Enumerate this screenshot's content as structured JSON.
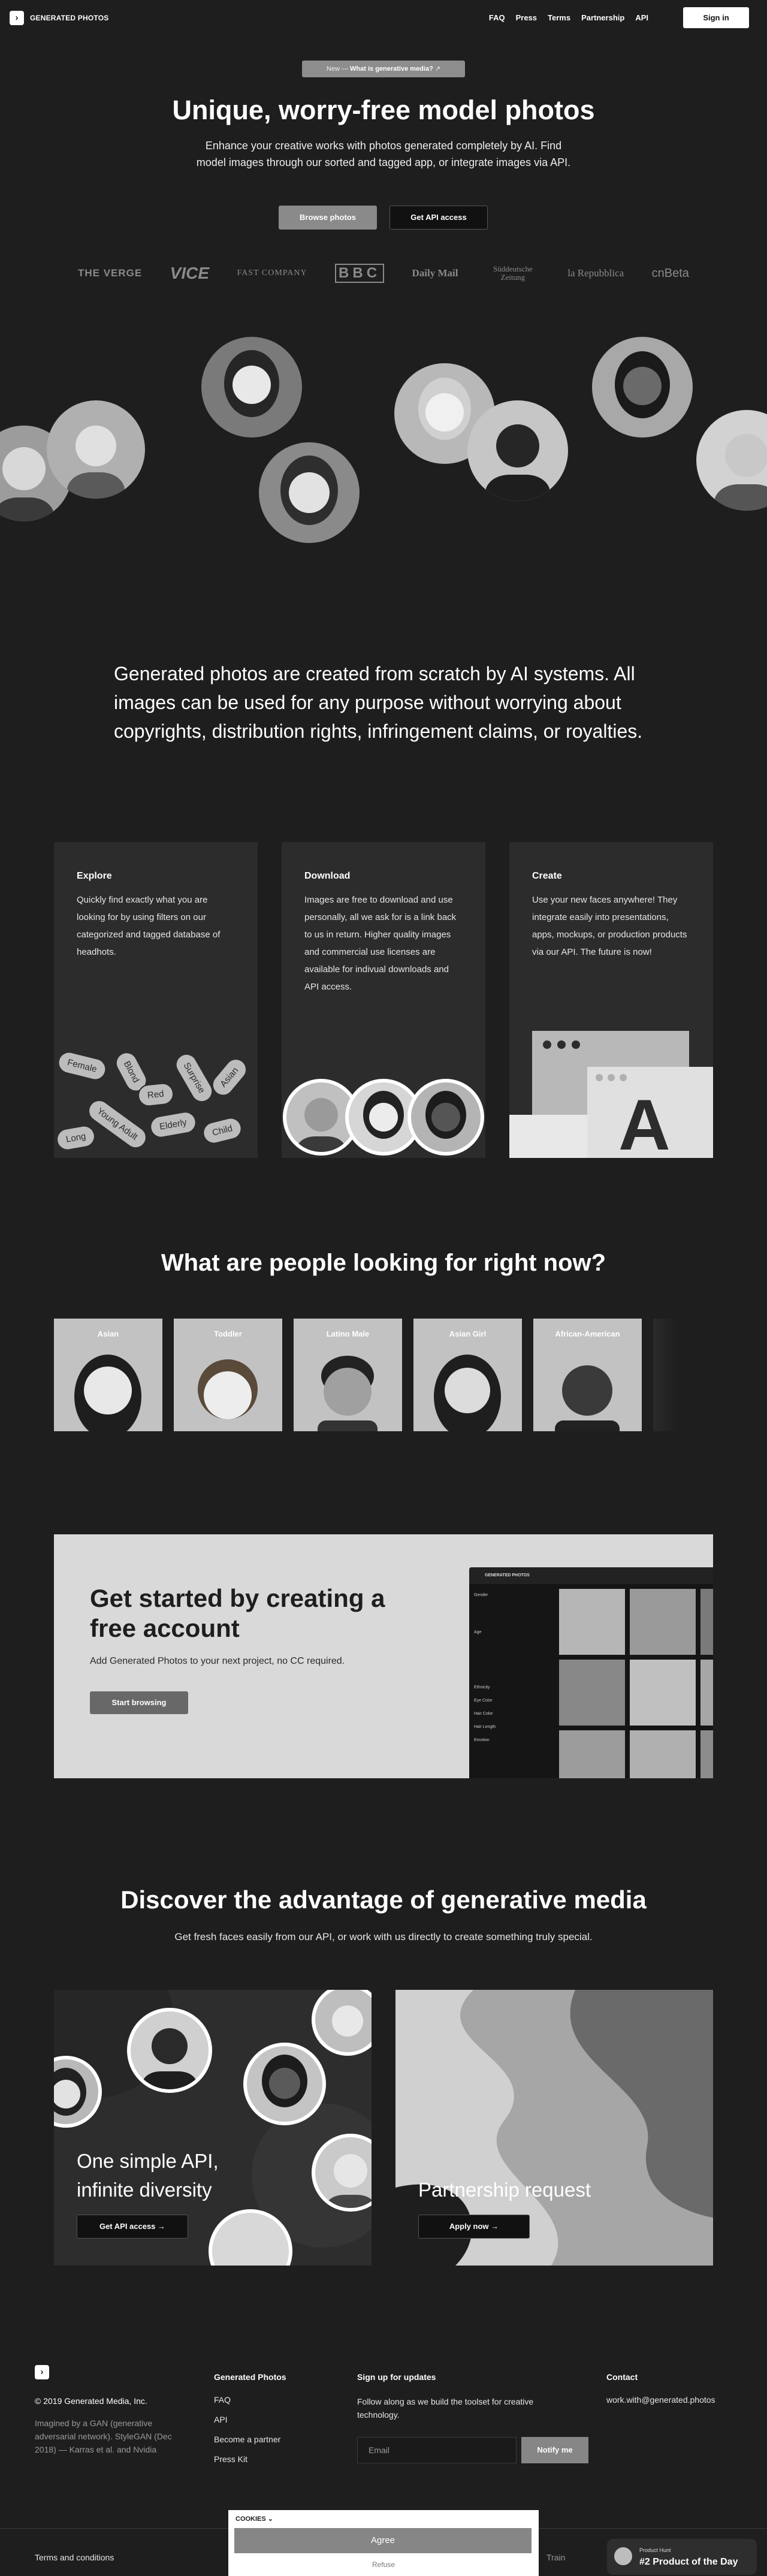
{
  "header": {
    "logo_text": "GENERATED PHOTOS",
    "nav": [
      "FAQ",
      "Press",
      "Terms",
      "Partnership",
      "API"
    ],
    "signin": "Sign in"
  },
  "hero": {
    "pill_prefix": "New —",
    "pill_link": "What is generative media?",
    "pill_arrow": "↗",
    "title": "Unique, worry-free model photos",
    "subtitle": "Enhance your creative works with photos generated completely by AI. Find model images through our sorted and tagged app, or integrate images via API.",
    "btn_browse": "Browse photos",
    "btn_api": "Get API access",
    "press": [
      "THE VERGE",
      "VICE",
      "FAST COMPANY",
      "BBC",
      "Daily Mail",
      "Süddeutsche Zeitung",
      "la Repubblica",
      "cnBeta"
    ]
  },
  "statement": "Generated photos are created from scratch by AI systems. All images can be used for any purpose without worrying about copyrights, distribution rights, infringement claims, or royalties.",
  "features": [
    {
      "title": "Explore",
      "text": "Quickly find exactly what you are looking for by using filters on our categorized and tagged database of headhots.",
      "tags": [
        "Female",
        "Blond",
        "Red",
        "Surprise",
        "Asian",
        "Young Adult",
        "Elderly",
        "Long",
        "Child"
      ]
    },
    {
      "title": "Download",
      "text": "Images are free to download and use personally, all we ask for is a link back to us in return. Higher quality images and commercial use licenses are available for indivual downloads and API access."
    },
    {
      "title": "Create",
      "text": "Use your new faces anywhere! They integrate easily into presentations, apps, mockups, or production products via our API. The future is now!"
    }
  ],
  "looking": {
    "title": "What are people looking for right now?",
    "categories": [
      "Asian",
      "Toddler",
      "Latino Male",
      "Asian Girl",
      "African-American"
    ]
  },
  "get_started": {
    "title": "Get started by creating a free account",
    "text": "Add Generated Photos to your next project, no CC required.",
    "button": "Start browsing",
    "app_title": "GENERATED PHOTOS",
    "app_filters": [
      "Gender",
      "Age",
      "Ethnicity",
      "Eye Color",
      "Hair Color",
      "Hair Length",
      "Emotion"
    ]
  },
  "discover": {
    "title": "Discover the advantage of generative media",
    "subtitle": "Get fresh faces easily from our API, or work with us directly to create something truly special.",
    "api_title": "One simple API, infinite diversity",
    "api_button": "Get API access",
    "partner_title": "Partnership request",
    "partner_button": "Apply now",
    "arrow": "→"
  },
  "footer": {
    "copyright": "© 2019 Generated Media, Inc.",
    "credit": "Imagined by a GAN (generative adversarial network). StyleGAN (Dec 2018) — Karras et al. and Nvidia",
    "col_title": "Generated Photos",
    "links": [
      "FAQ",
      "API",
      "Become a partner",
      "Press Kit"
    ],
    "signup_title": "Sign up for updates",
    "signup_text": "Follow along as we build the toolset for creative technology.",
    "email_placeholder": "Email",
    "notify": "Notify me",
    "contact_title": "Contact",
    "contact_email": "work.with@generated.photos",
    "terms": "Terms and conditions",
    "train": "Train"
  },
  "cookie": {
    "label": "COOKIES",
    "agree": "Agree",
    "refuse": "Refuse"
  },
  "product_hunt": {
    "label": "Product Hunt",
    "title": "#2 Product of the Day"
  }
}
